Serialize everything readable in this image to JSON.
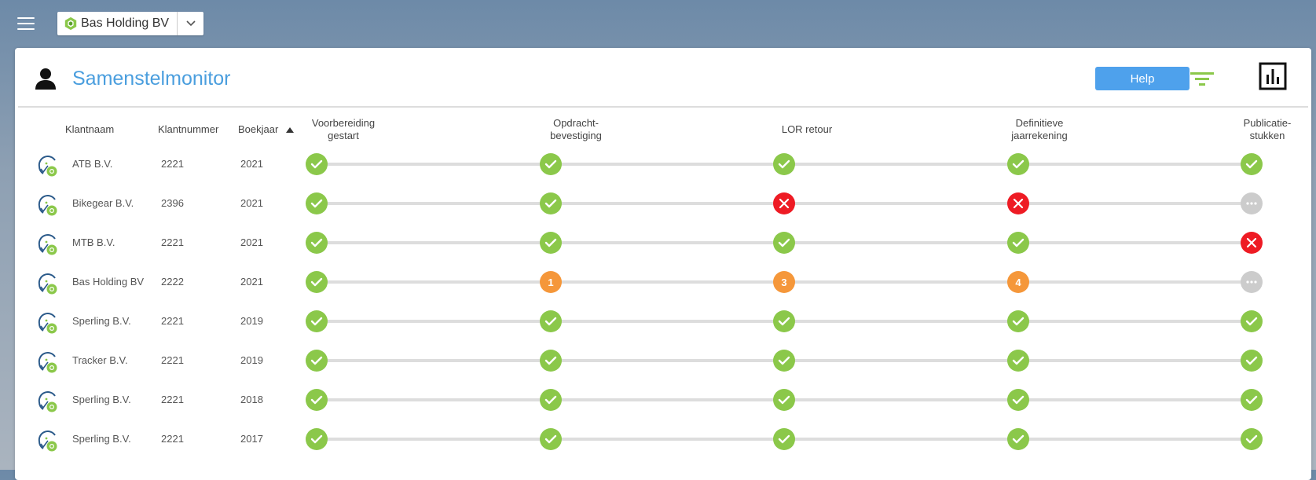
{
  "header": {
    "company_name": "Bas Holding BV",
    "brand_color": "#8bc84a"
  },
  "page": {
    "title": "Samenstelmonitor",
    "help_label": "Help",
    "accent_color": "#4ea1ec"
  },
  "columns": {
    "klantnaam": "Klantnaam",
    "klantnummer": "Klantnummer",
    "boekjaar": "Boekjaar",
    "stage1_line1": "Voorbereiding",
    "stage1_line2": "gestart",
    "stage2_line1": "Opdracht-",
    "stage2_line2": "bevestiging",
    "stage3": "LOR retour",
    "stage4_line1": "Definitieve",
    "stage4_line2": "jaarrekening",
    "stage5_line1": "Publicatie-",
    "stage5_line2": "stukken"
  },
  "status_colors": {
    "done": "#8bc84a",
    "fail": "#ee1b24",
    "pending": "#cccccc",
    "count": "#f5973a"
  },
  "rows": [
    {
      "name": "ATB B.V.",
      "number": "2221",
      "year": "2021",
      "stages": [
        "done",
        "done",
        "done",
        "done",
        "done"
      ]
    },
    {
      "name": "Bikegear B.V.",
      "number": "2396",
      "year": "2021",
      "stages": [
        "done",
        "done",
        "fail",
        "fail",
        "pending"
      ]
    },
    {
      "name": "MTB B.V.",
      "number": "2221",
      "year": "2021",
      "stages": [
        "done",
        "done",
        "done",
        "done",
        "fail"
      ]
    },
    {
      "name": "Bas Holding BV",
      "number": "2222",
      "year": "2021",
      "stages": [
        "done",
        "1",
        "3",
        "4",
        "pending"
      ]
    },
    {
      "name": "Sperling B.V.",
      "number": "2221",
      "year": "2019",
      "stages": [
        "done",
        "done",
        "done",
        "done",
        "done"
      ]
    },
    {
      "name": "Tracker B.V.",
      "number": "2221",
      "year": "2019",
      "stages": [
        "done",
        "done",
        "done",
        "done",
        "done"
      ]
    },
    {
      "name": "Sperling B.V.",
      "number": "2221",
      "year": "2018",
      "stages": [
        "done",
        "done",
        "done",
        "done",
        "done"
      ]
    },
    {
      "name": "Sperling B.V.",
      "number": "2221",
      "year": "2017",
      "stages": [
        "done",
        "done",
        "done",
        "done",
        "done"
      ]
    }
  ]
}
